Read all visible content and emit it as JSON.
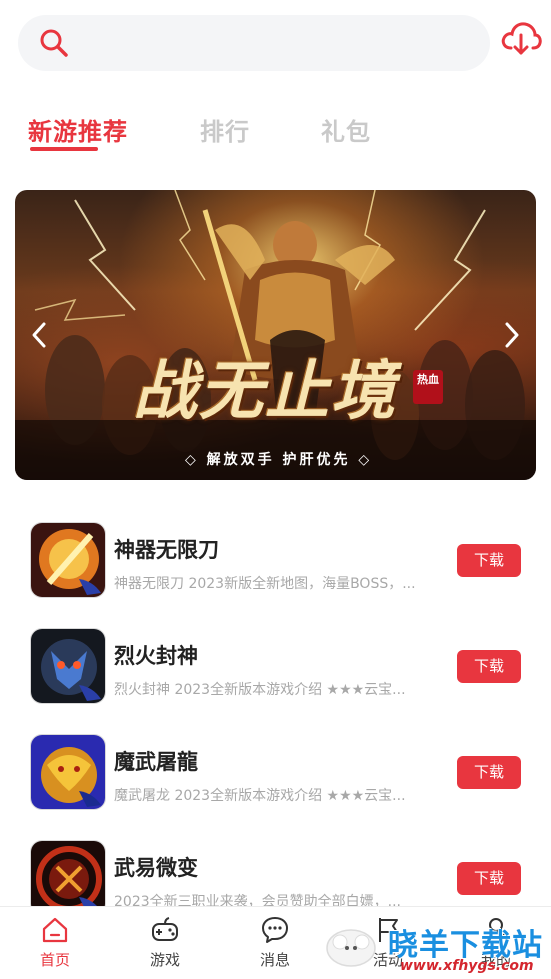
{
  "header": {
    "search_icon": "search-icon",
    "download_icon": "cloud-download-icon",
    "accent": "#e8363f"
  },
  "tabs": [
    {
      "label": "新游推荐",
      "active": true
    },
    {
      "label": "排行",
      "active": false
    },
    {
      "label": "礼包",
      "active": false
    }
  ],
  "banner": {
    "title": "战无止境",
    "subtitle": "◇ 解放双手  护肝优先 ◇",
    "badge": "热血",
    "prev_icon": "chevron-left-icon",
    "next_icon": "chevron-right-icon"
  },
  "games": [
    {
      "name": "神器无限刀",
      "desc": "神器无限刀 2023新版全新地图，海量BOSS，...",
      "button": "下载"
    },
    {
      "name": "烈火封神",
      "desc": "烈火封神 2023全新版本游戏介绍 ★★★云宝...",
      "button": "下载"
    },
    {
      "name": "魔武屠龍",
      "desc": "魔武屠龙 2023全新版本游戏介绍 ★★★云宝...",
      "button": "下载"
    },
    {
      "name": "武易微变",
      "desc": "2023全新三职业来袭，会员赞助全部白嫖，...",
      "button": "下载"
    }
  ],
  "nav": [
    {
      "label": "首页",
      "icon": "home-icon",
      "active": true
    },
    {
      "label": "游戏",
      "icon": "gamepad-icon",
      "active": false
    },
    {
      "label": "消息",
      "icon": "chat-bubble-icon",
      "active": false
    },
    {
      "label": "活动",
      "icon": "flag-icon",
      "active": false
    },
    {
      "label": "我的",
      "icon": "user-icon",
      "active": false
    }
  ],
  "watermark": {
    "text": "晓羊下载站",
    "url": "www.xfhygs.com"
  }
}
